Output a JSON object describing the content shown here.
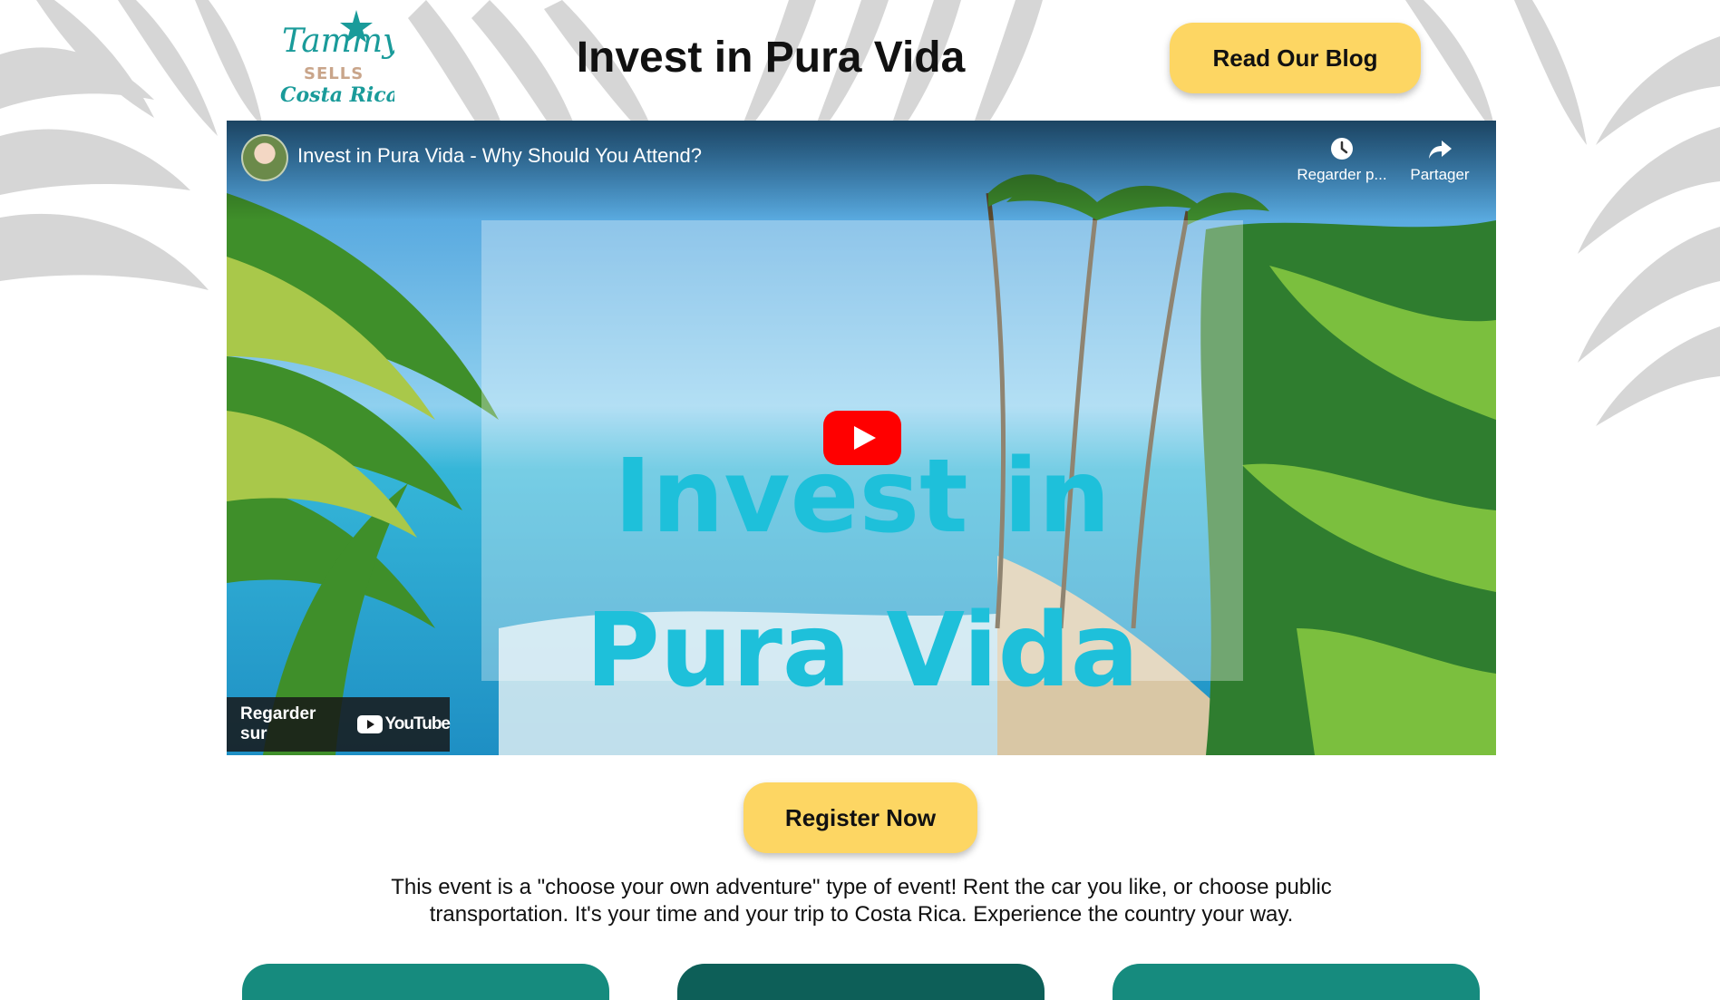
{
  "header": {
    "logo": {
      "line1": "Tammy",
      "line2": "SELLS",
      "line3": "Costa Rica"
    },
    "title": "Invest in Pura Vida",
    "blog_button": "Read Our Blog"
  },
  "video": {
    "title": "Invest in Pura Vida - Why Should You Attend?",
    "watch_later_label": "Regarder p...",
    "share_label": "Partager",
    "overlay_line1": "Invest in",
    "overlay_line2": "Pura Vida",
    "watch_on_label": "Regarder sur",
    "youtube_label": "YouTube"
  },
  "register_button": "Register Now",
  "description": "This event is a \"choose your own adventure\" type of event! Rent the car you like, or choose public transportation. It's your time and your trip to Costa Rica. Experience the country your way.",
  "colors": {
    "button_yellow": "#fdd663",
    "teal": "#168b7e",
    "dark_teal": "#0d5f58",
    "overlay_text": "#1ec0da",
    "youtube_red": "#ff0000",
    "leaf_gray": "#d6d6d6"
  }
}
